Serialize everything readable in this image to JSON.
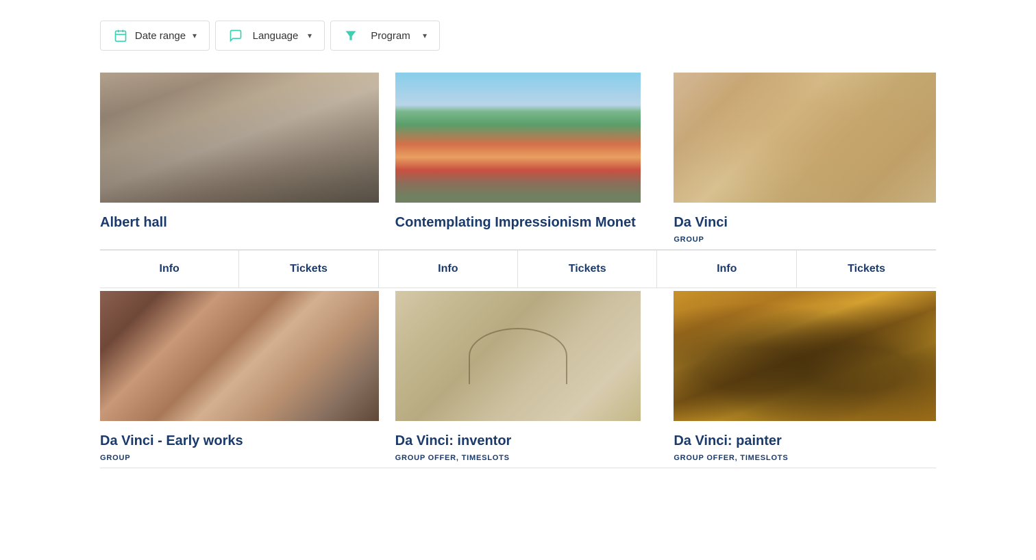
{
  "filters": {
    "dateRange": {
      "label": "Date range",
      "icon": "calendar"
    },
    "language": {
      "label": "Language",
      "icon": "chat"
    },
    "program": {
      "label": "Program",
      "icon": "filter"
    }
  },
  "row1": {
    "cards": [
      {
        "id": "albert-hall",
        "title": "Albert hall",
        "tag": "",
        "image": "albert-hall"
      },
      {
        "id": "monet",
        "title": "Contemplating Impressionism Monet",
        "tag": "",
        "image": "monet"
      },
      {
        "id": "davinci",
        "title": "Da Vinci",
        "tag": "GROUP",
        "image": "davinci-sketch"
      }
    ],
    "tabs": [
      {
        "info": "Info",
        "tickets": "Tickets"
      },
      {
        "info": "Info",
        "tickets": "Tickets"
      },
      {
        "info": "Info",
        "tickets": "Tickets"
      }
    ]
  },
  "row2": {
    "cards": [
      {
        "id": "early-works",
        "title": "Da Vinci - Early works",
        "tag": "GROUP",
        "image": "early-works"
      },
      {
        "id": "inventor",
        "title": "Da Vinci: inventor",
        "tag": "GROUP OFFER, TIMESLOTS",
        "image": "inventor"
      },
      {
        "id": "painter",
        "title": "Da Vinci: painter",
        "tag": "GROUP OFFER, TIMESLOTS",
        "image": "painter"
      }
    ]
  }
}
